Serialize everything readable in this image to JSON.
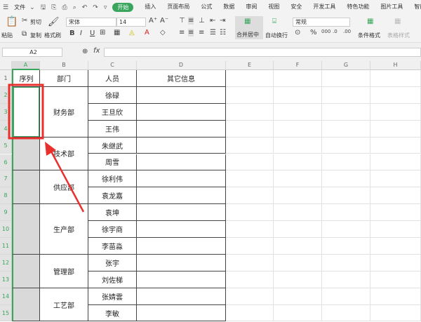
{
  "menu": {
    "file": "文件",
    "tabs": [
      "开始",
      "插入",
      "页面布局",
      "公式",
      "数据",
      "审阅",
      "视图",
      "安全",
      "开发工具",
      "特色功能",
      "图片工具",
      "智能工具箱"
    ],
    "active_tab": "开始"
  },
  "ribbon": {
    "paste": "粘贴",
    "cut": "剪切",
    "copy": "复制",
    "format_painter": "格式刷",
    "font": "宋体",
    "font_size": "14",
    "merge_center": "合并居中",
    "wrap_text": "自动换行",
    "number_format": "常规",
    "conditional_format": "条件格式",
    "table_style": "表格样式",
    "bold": "B",
    "italic": "I",
    "underline": "U",
    "percent": "%"
  },
  "formula_bar": {
    "name_box": "A2",
    "fx": "fx",
    "value": ""
  },
  "columns": [
    "A",
    "B",
    "C",
    "D",
    "E",
    "F",
    "G",
    "H"
  ],
  "rows": [
    "1",
    "2",
    "3",
    "4",
    "5",
    "6",
    "7",
    "8",
    "9",
    "10",
    "11",
    "12",
    "13",
    "14",
    "15"
  ],
  "table": {
    "headers": [
      "序列",
      "部门",
      "人员",
      "其它信息"
    ],
    "departments": [
      {
        "name": "财务部",
        "people": [
          "徐碌",
          "王旦欣",
          "王伟"
        ]
      },
      {
        "name": "技术部",
        "people": [
          "朱继武",
          "周雪"
        ]
      },
      {
        "name": "供应部",
        "people": [
          "徐利伟",
          "袁龙嘉"
        ]
      },
      {
        "name": "生产部",
        "people": [
          "袁坤",
          "徐宇商",
          "李苗淼"
        ]
      },
      {
        "name": "管理部",
        "people": [
          "张宇",
          "刘佐梯"
        ]
      },
      {
        "name": "工艺部",
        "people": [
          "张婧雲",
          "李敏"
        ]
      }
    ]
  },
  "colors": {
    "accent": "#3aa55c",
    "annotation": "#e8312f"
  }
}
